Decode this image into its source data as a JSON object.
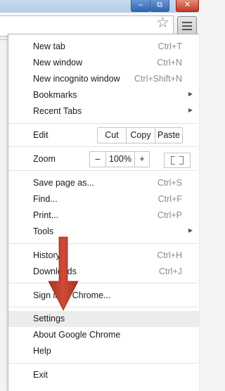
{
  "window": {
    "min_glyph": "–",
    "max_glyph": "⧉",
    "close_glyph": "✕"
  },
  "toolbar": {
    "star_glyph": "☆"
  },
  "menu": {
    "new_tab": {
      "label": "New tab",
      "shortcut": "Ctrl+T"
    },
    "new_window": {
      "label": "New window",
      "shortcut": "Ctrl+N"
    },
    "new_incognito": {
      "label": "New incognito window",
      "shortcut": "Ctrl+Shift+N"
    },
    "bookmarks": {
      "label": "Bookmarks"
    },
    "recent_tabs": {
      "label": "Recent Tabs"
    },
    "edit": {
      "label": "Edit",
      "cut": "Cut",
      "copy": "Copy",
      "paste": "Paste"
    },
    "zoom": {
      "label": "Zoom",
      "minus": "–",
      "level": "100%",
      "plus": "+"
    },
    "save_page": {
      "label": "Save page as...",
      "shortcut": "Ctrl+S"
    },
    "find": {
      "label": "Find...",
      "shortcut": "Ctrl+F"
    },
    "print": {
      "label": "Print...",
      "shortcut": "Ctrl+P"
    },
    "tools": {
      "label": "Tools"
    },
    "history": {
      "label": "History",
      "shortcut": "Ctrl+H"
    },
    "downloads": {
      "label": "Downloads",
      "shortcut": "Ctrl+J"
    },
    "sign_in": {
      "label": "Sign in to Chrome..."
    },
    "settings": {
      "label": "Settings"
    },
    "about": {
      "label": "About Google Chrome"
    },
    "help": {
      "label": "Help"
    },
    "exit": {
      "label": "Exit"
    },
    "submenu_arrow": "▶"
  },
  "annotation": {
    "arrow_color": "#c0392b",
    "points_to": "Settings"
  }
}
